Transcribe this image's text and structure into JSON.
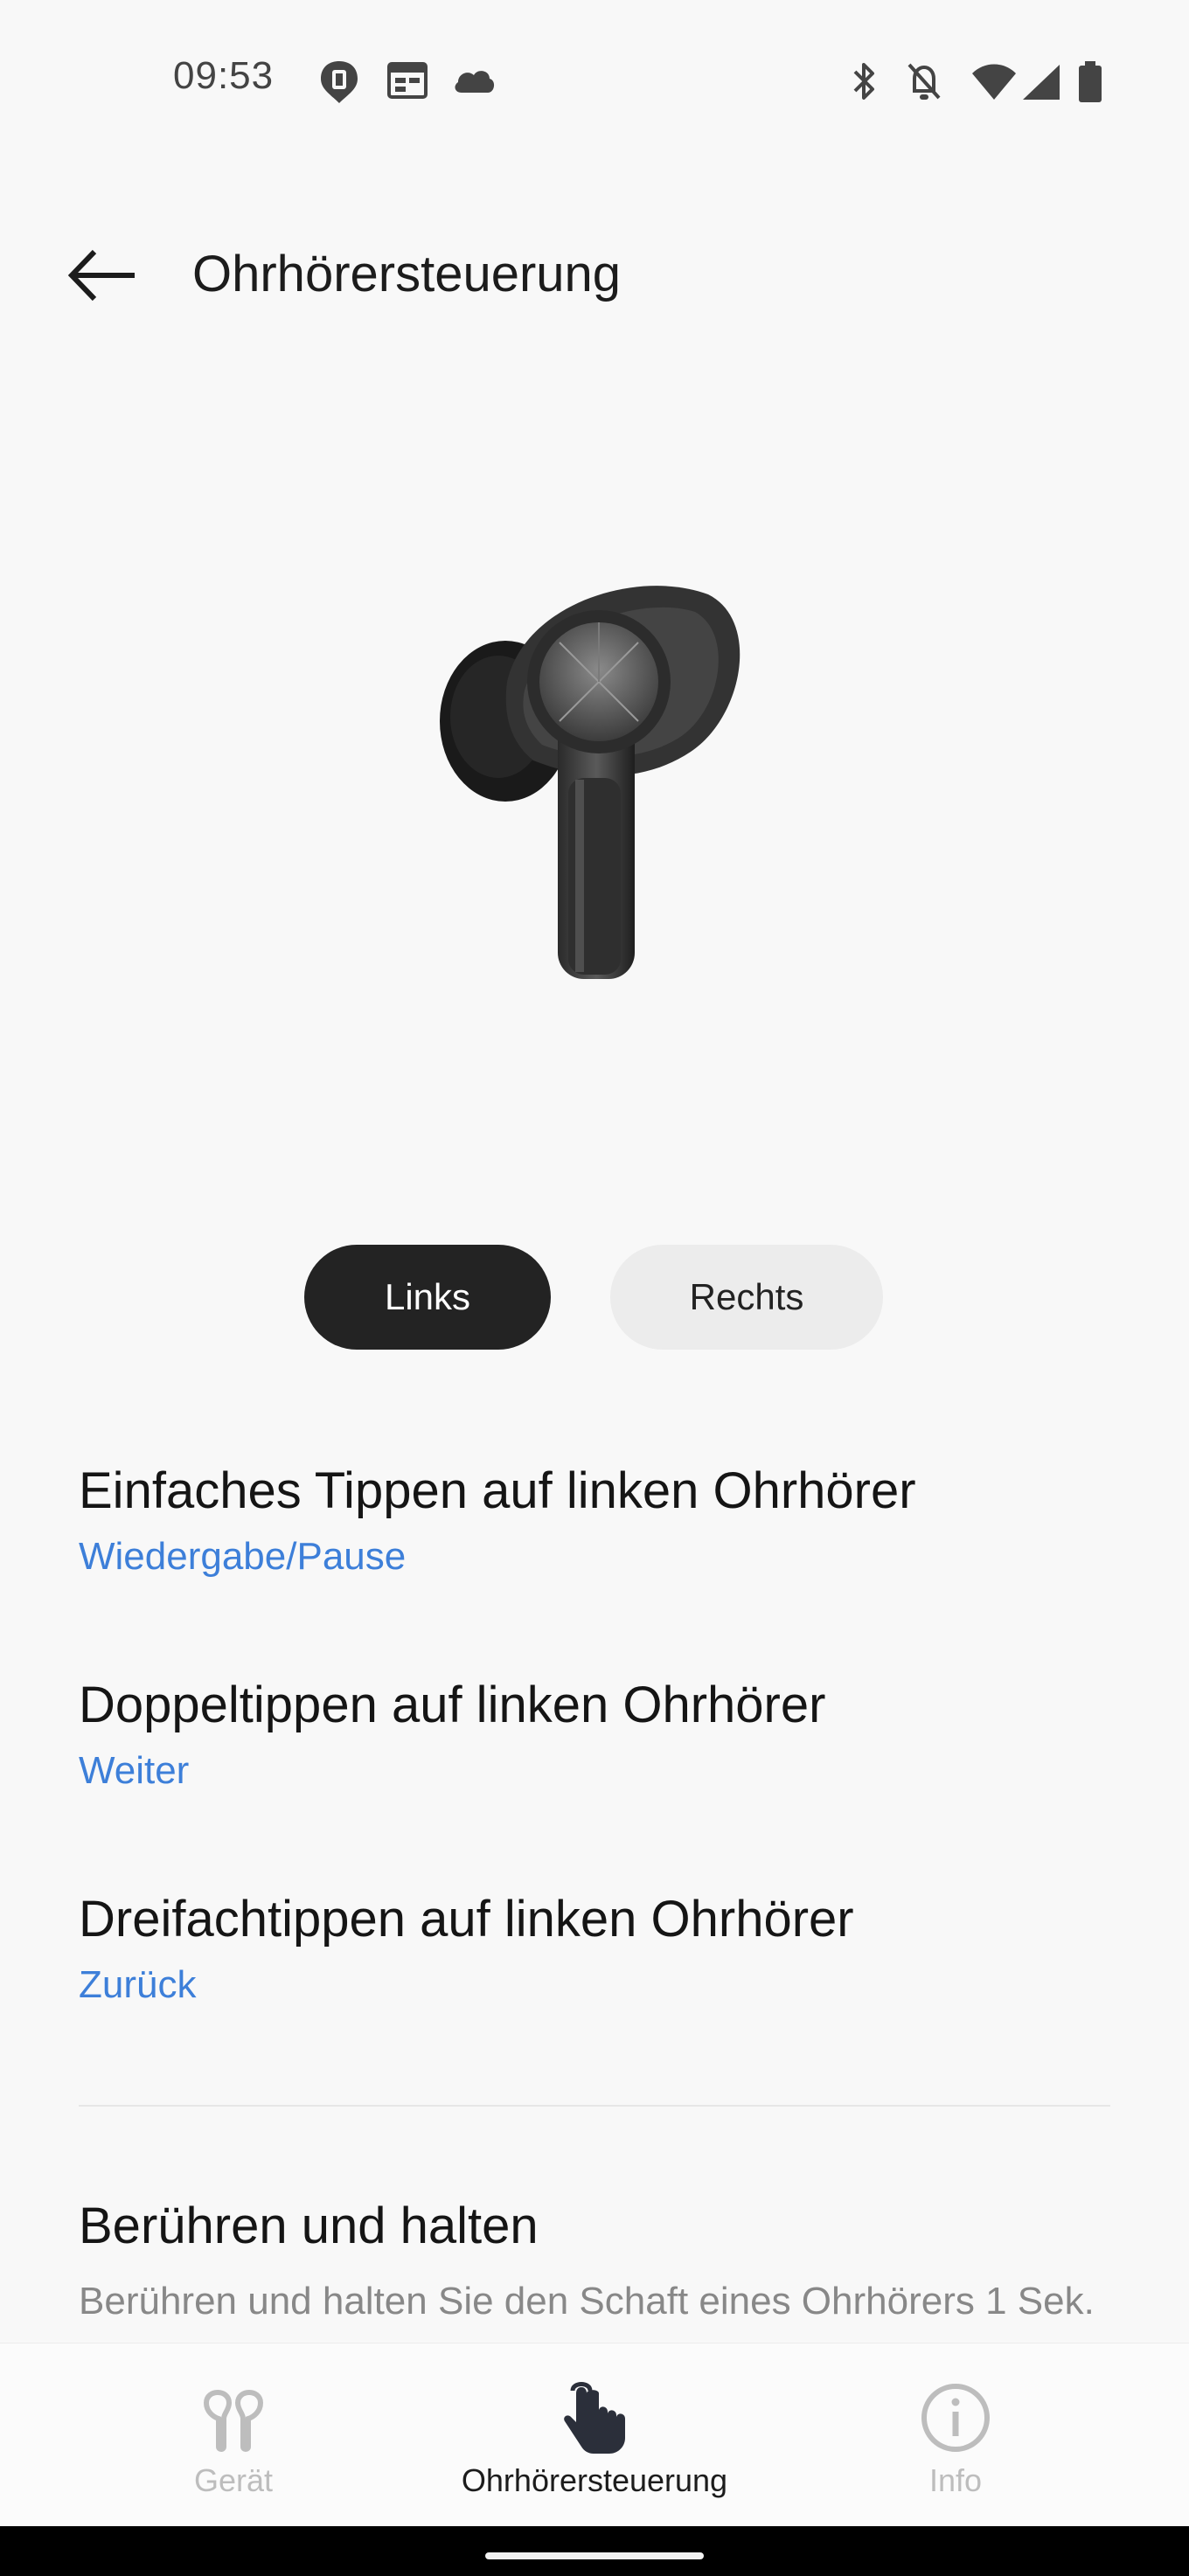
{
  "status_bar": {
    "time": "09:53",
    "left_icons": [
      "notification-pin-icon",
      "calendar-icon",
      "cloud-icon"
    ],
    "right_icons": [
      "bluetooth-icon",
      "bell-off-icon",
      "wifi-icon",
      "signal-icon",
      "battery-icon"
    ]
  },
  "app_bar": {
    "back_icon": "arrow-left-icon",
    "title": "Ohrhörersteuerung"
  },
  "earbud_image": "earbud-left-image",
  "segment": {
    "left": "Links",
    "right": "Rechts",
    "selected": "Links"
  },
  "settings": [
    {
      "title": "Einfaches Tippen auf linken Ohrhörer",
      "value": "Wiedergabe/Pause"
    },
    {
      "title": "Doppeltippen auf linken Ohrhörer",
      "value": "Weiter"
    },
    {
      "title": "Dreifachtippen auf linken Ohrhörer",
      "value": "Zurück"
    }
  ],
  "hold": {
    "title": "Berühren und halten",
    "description": "Berühren und halten Sie den Schaft eines Ohrhörers 1 Sek."
  },
  "bottom_nav": {
    "items": [
      {
        "label": "Gerät",
        "icon": "earbuds-icon",
        "active": false
      },
      {
        "label": "Ohrhörersteuerung",
        "icon": "touch-hand-icon",
        "active": true
      },
      {
        "label": "Info",
        "icon": "info-icon",
        "active": false
      }
    ]
  },
  "colors": {
    "accent_blue": "#3d7fd9",
    "selected_segment": "#232323",
    "inactive_nav": "#bdbdbd",
    "active_nav": "#2b2f3a"
  }
}
